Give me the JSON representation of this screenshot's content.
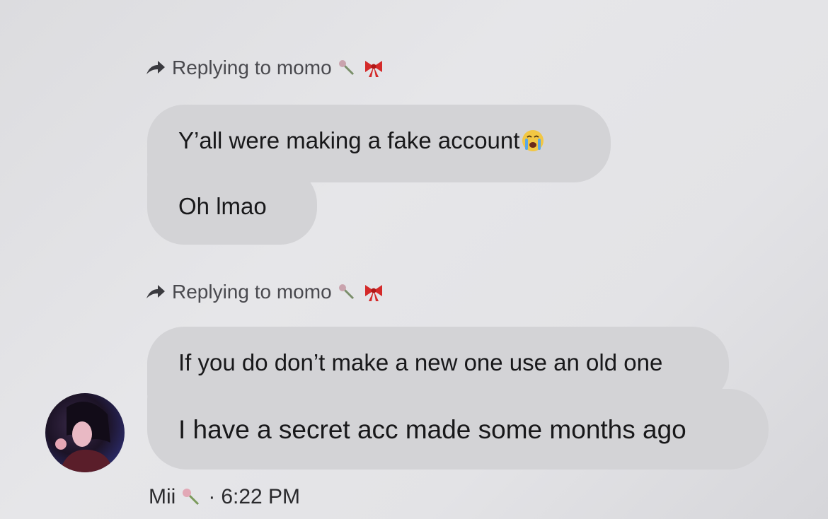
{
  "replies": [
    {
      "prefix": "Replying to momo"
    },
    {
      "prefix": "Replying to momo"
    }
  ],
  "messages": [
    {
      "text": "Y’all were making a fake account"
    },
    {
      "text": "Oh lmao"
    },
    {
      "text": "If you do don’t make a new one use an old one"
    },
    {
      "text": "I have a secret acc made some months ago"
    }
  ],
  "footer": {
    "sender": "Mii",
    "separator": "·",
    "time": "6:22 PM"
  },
  "icons": {
    "reply": "reply-arrow-icon",
    "name_emoji_1": "rose-icon",
    "name_emoji_2": "ribbon-icon",
    "crying": "crying-face-icon"
  },
  "colors": {
    "bubble": "#d3d3d6",
    "background": "#e4e4e7",
    "ribbon": "#d42a2a"
  }
}
